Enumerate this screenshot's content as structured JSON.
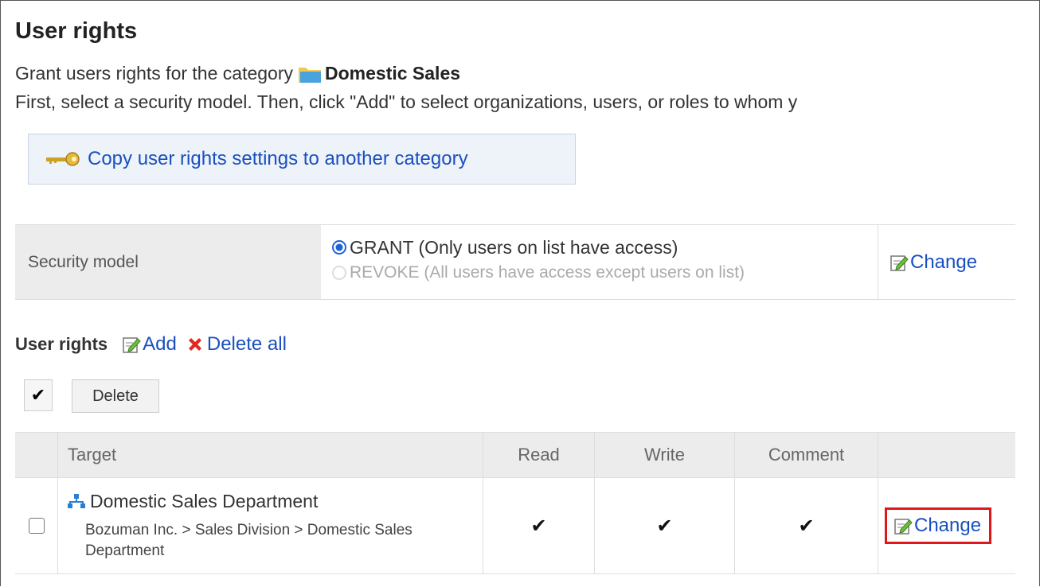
{
  "header": {
    "title": "User rights",
    "grant_prefix": "Grant users rights for the category",
    "category_name": "Domestic Sales",
    "instructions": "First, select a security model. Then, click \"Add\" to select organizations, users, or roles to whom y"
  },
  "copy_button": {
    "label": "Copy user rights settings to another category"
  },
  "security_model": {
    "label": "Security model",
    "options": [
      {
        "label": "GRANT (Only users on list have access)",
        "selected": true
      },
      {
        "label": "REVOKE (All users have access except users on list)",
        "selected": false
      }
    ],
    "change_label": "Change"
  },
  "user_rights": {
    "heading": "User rights",
    "add_label": "Add",
    "delete_all_label": "Delete all",
    "check_label": "✔",
    "delete_label": "Delete"
  },
  "table": {
    "headers": [
      "Target",
      "Read",
      "Write",
      "Comment"
    ],
    "rows": [
      {
        "name": "Domestic Sales Department",
        "path": "Bozuman Inc. > Sales Division > Domestic Sales Department",
        "read": "✔",
        "write": "✔",
        "comment": "✔",
        "change_label": "Change",
        "checked": false
      }
    ]
  },
  "colors": {
    "link": "#1a4fbf",
    "highlight_border": "#e0161c",
    "radio": "#1e63d6"
  }
}
